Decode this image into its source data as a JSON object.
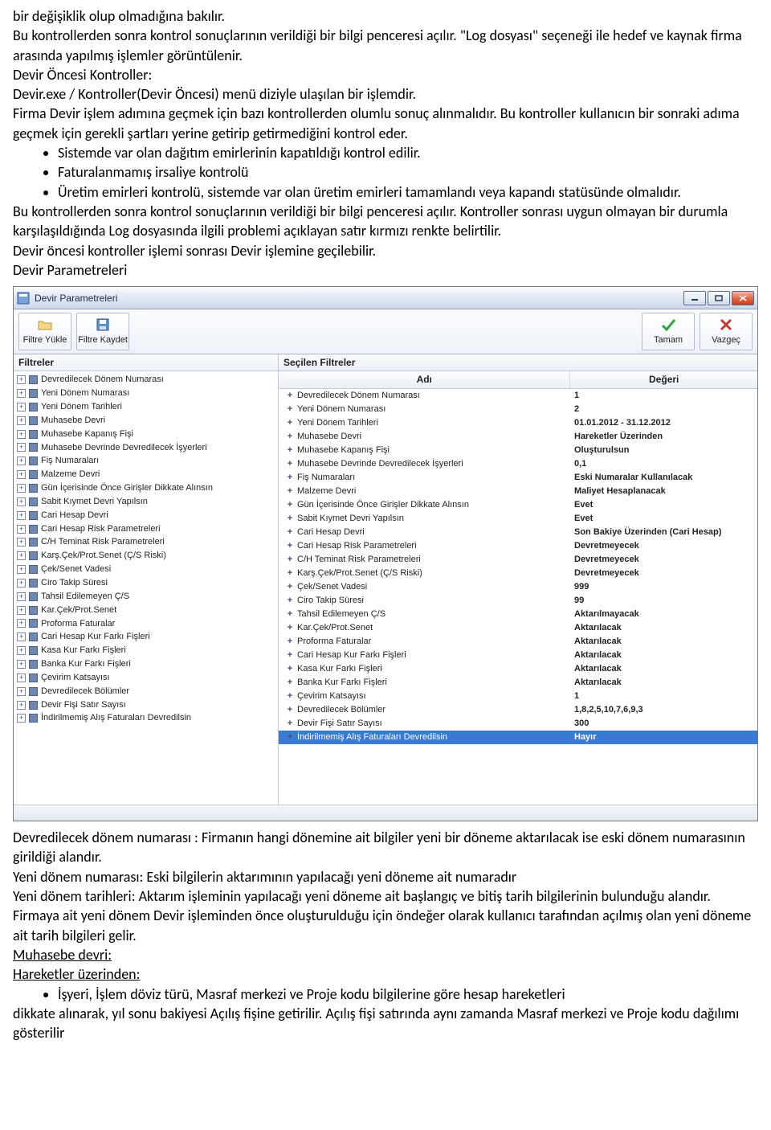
{
  "doc": {
    "p0": "bir değişiklik olup olmadığına bakılır.",
    "p1": "Bu kontrollerden sonra kontrol sonuçlarının verildiği bir bilgi penceresi açılır. \"Log dosyası\" seçeneği ile hedef ve kaynak firma arasında yapılmış işlemler görüntülenir.",
    "h1": "Devir Öncesi Kontroller:",
    "p2": "Devir.exe / Kontroller(Devir Öncesi) menü diziyle ulaşılan bir işlemdir.",
    "p3": "Firma Devir işlem adımına geçmek için bazı kontrollerden olumlu sonuç alınmalıdır. Bu kontroller kullanıcın bir sonraki adıma geçmek için gerekli şartları yerine getirip getirmediğini kontrol eder.",
    "b1": "Sistemde var olan dağıtım emirlerinin kapatıldığı kontrol edilir.",
    "b2": "Faturalanmamış irsaliye kontrolü",
    "b3": "Üretim emirleri kontrolü, sistemde var olan üretim emirleri tamamlandı veya kapandı statüsünde olmalıdır.",
    "p4": "Bu kontrollerden sonra kontrol sonuçlarının verildiği bir bilgi penceresi açılır. Kontroller sonrası uygun olmayan bir durumla karşılaşıldığında Log dosyasında ilgili problemi açıklayan satır kırmızı renkte belirtilir.",
    "p5": "Devir öncesi kontroller işlemi sonrası Devir işlemine geçilebilir.",
    "h2": "Devir Parametreleri",
    "p6": "Devredilecek dönem numarası : Firmanın hangi dönemine ait bilgiler yeni bir döneme aktarılacak ise eski dönem numarasının girildiği alandır.",
    "p7": "Yeni dönem numarası: Eski bilgilerin aktarımının yapılacağı yeni döneme ait numaradır",
    "p8": "Yeni dönem tarihleri: Aktarım işleminin yapılacağı yeni döneme ait başlangıç ve bitiş tarih bilgilerinin bulunduğu alandır. Firmaya ait yeni dönem Devir işleminden önce oluşturulduğu için öndeğer olarak kullanıcı tarafından açılmış olan yeni döneme ait tarih bilgileri gelir.",
    "p9a": "Muhasebe devri:",
    "p9b": "Hareketler üzerinden:",
    "b4": "İşyeri, İşlem döviz türü, Masraf merkezi ve Proje kodu bilgilerine göre hesap hareketleri",
    "p10": "dikkate alınarak, yıl sonu bakiyesi Açılış fişine getirilir. Açılış fişi satırında aynı zamanda Masraf merkezi ve Proje kodu dağılımı gösterilir"
  },
  "win": {
    "title": "Devir Parametreleri",
    "toolbar": {
      "load": "Filtre Yükle",
      "save": "Filtre Kaydet",
      "ok": "Tamam",
      "cancel": "Vazgeç"
    },
    "leftHeader": "Filtreler",
    "rightHeaderSub": "Seçilen Filtreler",
    "rightHeaderName": "Adı",
    "rightHeaderValue": "Değeri",
    "tree": [
      "Devredilecek Dönem Numarası",
      "Yeni Dönem Numarası",
      "Yeni Dönem Tarihleri",
      "Muhasebe Devri",
      "Muhasebe Kapanış Fişi",
      "Muhasebe Devrinde Devredilecek İşyerleri",
      "Fiş Numaraları",
      "Malzeme Devri",
      "Gün İçerisinde Önce Girişler Dikkate Alınsın",
      "Sabit Kıymet Devri Yapılsın",
      "Cari Hesap Devri",
      "Cari Hesap Risk Parametreleri",
      "C/H Teminat Risk Parametreleri",
      "Karş.Çek/Prot.Senet (Ç/S Riski)",
      "Çek/Senet Vadesi",
      "Ciro Takip Süresi",
      "Tahsil Edilemeyen Ç/S",
      "Kar.Çek/Prot.Senet",
      "Proforma Faturalar",
      "Cari Hesap Kur Farkı Fişleri",
      "Kasa Kur Farkı Fişleri",
      "Banka Kur Farkı Fişleri",
      "Çevirim Katsayısı",
      "Devredilecek Bölümler",
      "Devir Fişi Satır Sayısı",
      "İndirilmemiş Alış Faturaları Devredilsin"
    ],
    "grid": [
      {
        "name": "Devredilecek Dönem Numarası",
        "value": "1"
      },
      {
        "name": "Yeni Dönem Numarası",
        "value": "2"
      },
      {
        "name": "Yeni Dönem Tarihleri",
        "value": "01.01.2012 - 31.12.2012"
      },
      {
        "name": "Muhasebe Devri",
        "value": "Hareketler Üzerinden"
      },
      {
        "name": "Muhasebe Kapanış Fişi",
        "value": "Oluşturulsun"
      },
      {
        "name": "Muhasebe Devrinde Devredilecek İşyerleri",
        "value": "0,1"
      },
      {
        "name": "Fiş Numaraları",
        "value": "Eski Numaralar Kullanılacak"
      },
      {
        "name": "Malzeme Devri",
        "value": "Maliyet Hesaplanacak"
      },
      {
        "name": "Gün İçerisinde Önce Girişler Dikkate Alınsın",
        "value": "Evet"
      },
      {
        "name": "Sabit Kıymet Devri Yapılsın",
        "value": "Evet"
      },
      {
        "name": "Cari Hesap Devri",
        "value": "Son Bakiye Üzerinden (Cari Hesap)"
      },
      {
        "name": "Cari Hesap Risk Parametreleri",
        "value": "Devretmeyecek"
      },
      {
        "name": "C/H Teminat Risk Parametreleri",
        "value": "Devretmeyecek"
      },
      {
        "name": "Karş.Çek/Prot.Senet (Ç/S Riski)",
        "value": "Devretmeyecek"
      },
      {
        "name": "Çek/Senet Vadesi",
        "value": "999"
      },
      {
        "name": "Ciro Takip Süresi",
        "value": "99"
      },
      {
        "name": "Tahsil Edilemeyen Ç/S",
        "value": "Aktarılmayacak"
      },
      {
        "name": "Kar.Çek/Prot.Senet",
        "value": "Aktarılacak"
      },
      {
        "name": "Proforma Faturalar",
        "value": "Aktarılacak"
      },
      {
        "name": "Cari Hesap Kur Farkı Fişleri",
        "value": "Aktarılacak"
      },
      {
        "name": "Kasa Kur Farkı Fişleri",
        "value": "Aktarılacak"
      },
      {
        "name": "Banka Kur Farkı Fişleri",
        "value": "Aktarılacak"
      },
      {
        "name": "Çevirim Katsayısı",
        "value": "1"
      },
      {
        "name": "Devredilecek Bölümler",
        "value": "1,8,2,5,10,7,6,9,3"
      },
      {
        "name": "Devir Fişi Satır Sayısı",
        "value": "300"
      },
      {
        "name": "İndirilmemiş Alış Faturaları Devredilsin",
        "value": "Hayır",
        "selected": true
      }
    ]
  }
}
